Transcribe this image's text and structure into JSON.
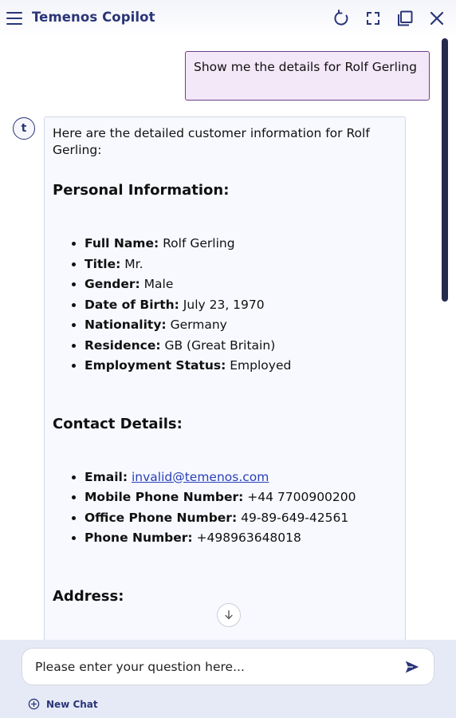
{
  "header": {
    "title": "Temenos Copilot"
  },
  "chat": {
    "user_message": "Show me the details for Rolf Gerling",
    "avatar_letter": "t",
    "bot": {
      "intro": "Here are the detailed customer information for Rolf Gerling:",
      "personal_heading": "Personal Information:",
      "personal_items": [
        {
          "label": "Full Name:",
          "value": "Rolf Gerling"
        },
        {
          "label": "Title:",
          "value": "Mr."
        },
        {
          "label": "Gender:",
          "value": "Male"
        },
        {
          "label": "Date of Birth:",
          "value": "July 23, 1970"
        },
        {
          "label": "Nationality:",
          "value": "Germany"
        },
        {
          "label": "Residence:",
          "value": "GB (Great Britain)"
        },
        {
          "label": "Employment Status:",
          "value": "Employed"
        }
      ],
      "contact_heading": "Contact Details:",
      "contact_items": [
        {
          "label": "Email:",
          "value": "invalid@temenos.com"
        },
        {
          "label": "Mobile Phone Number:",
          "value": "+44 7700900200"
        },
        {
          "label": "Office Phone Number:",
          "value": "49-89-649-42561"
        },
        {
          "label": "Phone Number:",
          "value": "+498963648018"
        }
      ],
      "address_heading": "Address:"
    }
  },
  "footer": {
    "input_placeholder": "Please enter your question here...",
    "new_chat_label": "New Chat"
  },
  "icons": {
    "menu": "menu-icon",
    "refresh": "refresh-icon",
    "fullscreen": "fullscreen-icon",
    "popout": "popout-icon",
    "close": "close-icon",
    "scroll_down": "arrow-down-icon",
    "send": "send-icon",
    "new_chat": "plus-circle-icon"
  },
  "colors": {
    "brand": "#2a3578",
    "user_bubble_bg": "#f3e8f8",
    "user_bubble_border": "#6b3d8a",
    "bot_bubble_bg": "#f7f9ff",
    "footer_bg": "#e6eaf6",
    "link": "#2a3fb8"
  }
}
